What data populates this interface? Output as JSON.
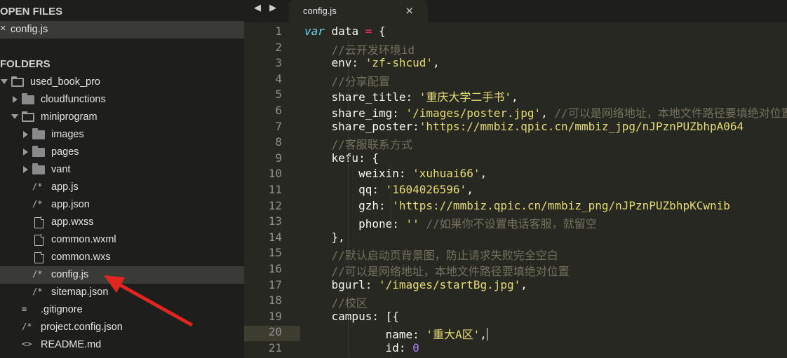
{
  "sidebar": {
    "open_files_title": "OPEN FILES",
    "open_file": {
      "label": "config.js",
      "close": "×"
    },
    "folders_title": "FOLDERS",
    "tree": [
      {
        "label": "used_book_pro",
        "kind": "folder-open",
        "indent": 0
      },
      {
        "label": "cloudfunctions",
        "kind": "folder",
        "indent": 1
      },
      {
        "label": "miniprogram",
        "kind": "folder-open",
        "indent": 1
      },
      {
        "label": "images",
        "kind": "folder",
        "indent": 2
      },
      {
        "label": "pages",
        "kind": "folder",
        "indent": 2
      },
      {
        "label": "vant",
        "kind": "folder",
        "indent": 2
      },
      {
        "label": "app.js",
        "kind": "js",
        "indent": 2
      },
      {
        "label": "app.json",
        "kind": "js",
        "indent": 2
      },
      {
        "label": "app.wxss",
        "kind": "doc",
        "indent": 2
      },
      {
        "label": "common.wxml",
        "kind": "doc",
        "indent": 2
      },
      {
        "label": "common.wxs",
        "kind": "doc",
        "indent": 2
      },
      {
        "label": "config.js",
        "kind": "js",
        "indent": 2,
        "selected": true
      },
      {
        "label": "sitemap.json",
        "kind": "js",
        "indent": 2
      },
      {
        "label": ".gitignore",
        "kind": "lines",
        "indent": 1
      },
      {
        "label": "project.config.json",
        "kind": "js",
        "indent": 1
      },
      {
        "label": "README.md",
        "kind": "md",
        "indent": 1
      }
    ]
  },
  "tabs": {
    "nav": "◀ ▶",
    "active": {
      "label": "config.js",
      "close": "×"
    }
  },
  "editor": {
    "current_line": 20,
    "lines": [
      {
        "n": "1",
        "t": [
          [
            "k",
            "var"
          ],
          [
            "p",
            " data "
          ],
          [
            "o",
            "="
          ],
          [
            "p",
            " {"
          ]
        ]
      },
      {
        "n": "2",
        "t": [
          [
            "c",
            "    //云开发环境id"
          ]
        ]
      },
      {
        "n": "3",
        "t": [
          [
            "p",
            "    env: "
          ],
          [
            "s",
            "'zf-shcud'"
          ],
          [
            "p",
            ","
          ]
        ]
      },
      {
        "n": "4",
        "t": [
          [
            "c",
            "    //分享配置"
          ]
        ]
      },
      {
        "n": "5",
        "t": [
          [
            "p",
            "    share_title: "
          ],
          [
            "s",
            "'重庆大学二手书'"
          ],
          [
            "p",
            ","
          ]
        ]
      },
      {
        "n": "6",
        "t": [
          [
            "p",
            "    share_img: "
          ],
          [
            "s",
            "'/images/poster.jpg'"
          ],
          [
            "p",
            ", "
          ],
          [
            "c",
            "//可以是网络地址，本地文件路径要填绝对位置"
          ]
        ]
      },
      {
        "n": "7",
        "t": [
          [
            "p",
            "    share_poster:"
          ],
          [
            "s",
            "'https://mmbiz.qpic.cn/mmbiz_jpg/nJPznPUZbhpA064"
          ]
        ]
      },
      {
        "n": "8",
        "t": [
          [
            "c",
            "    //客服联系方式"
          ]
        ]
      },
      {
        "n": "9",
        "t": [
          [
            "p",
            "    kefu: {"
          ]
        ]
      },
      {
        "n": "10",
        "t": [
          [
            "p",
            "        weixin: "
          ],
          [
            "s",
            "'xuhuai66'"
          ],
          [
            "p",
            ","
          ]
        ]
      },
      {
        "n": "11",
        "t": [
          [
            "p",
            "        qq: "
          ],
          [
            "s",
            "'1604026596'"
          ],
          [
            "p",
            ","
          ]
        ]
      },
      {
        "n": "12",
        "t": [
          [
            "p",
            "        gzh: "
          ],
          [
            "s",
            "'https://mmbiz.qpic.cn/mmbiz_png/nJPznPUZbhpKCwnib"
          ]
        ]
      },
      {
        "n": "13",
        "t": [
          [
            "p",
            "        phone: "
          ],
          [
            "s",
            "''"
          ],
          [
            "p",
            " "
          ],
          [
            "c",
            "//如果你不设置电话客服，就留空"
          ]
        ]
      },
      {
        "n": "14",
        "t": [
          [
            "p",
            "    },"
          ]
        ]
      },
      {
        "n": "15",
        "t": [
          [
            "c",
            "    //默认启动页背景图，防止请求失败完全空白"
          ]
        ]
      },
      {
        "n": "16",
        "t": [
          [
            "c",
            "    //可以是网络地址，本地文件路径要填绝对位置"
          ]
        ]
      },
      {
        "n": "17",
        "t": [
          [
            "p",
            "    bgurl: "
          ],
          [
            "s",
            "'/images/startBg.jpg'"
          ],
          [
            "p",
            ","
          ]
        ]
      },
      {
        "n": "18",
        "t": [
          [
            "c",
            "    //校区"
          ]
        ]
      },
      {
        "n": "19",
        "t": [
          [
            "p",
            "    campus: [{"
          ]
        ]
      },
      {
        "n": "20",
        "t": [
          [
            "p",
            "            name: "
          ],
          [
            "s",
            "'重大A区'"
          ],
          [
            "p",
            ","
          ],
          [
            "cursor",
            ""
          ]
        ]
      },
      {
        "n": "21",
        "t": [
          [
            "p",
            "            id: "
          ],
          [
            "n",
            "0"
          ]
        ]
      }
    ]
  },
  "colors": {
    "sidebar_bg": "#1e1f1c",
    "editor_bg": "#272822",
    "selected_row": "#3a3b37",
    "annotation_arrow": "#e0261e"
  }
}
